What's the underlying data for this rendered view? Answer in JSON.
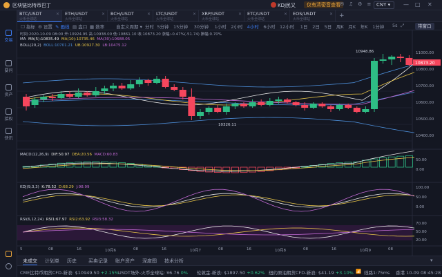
{
  "titlebar": {
    "app_title": "区块链比特币巴丁",
    "user_name": "KDJ民又",
    "badge": "仅有清密音查看",
    "currency": "CNY"
  },
  "sidebar": {
    "items": [
      {
        "label": "交易",
        "icon": "exchange-icon"
      },
      {
        "label": "要问",
        "icon": "news-icon"
      },
      {
        "label": "资产",
        "icon": "wallet-icon"
      },
      {
        "label": "接权",
        "icon": "key-icon"
      },
      {
        "label": "快讯",
        "icon": "flash-icon"
      }
    ]
  },
  "tabs": [
    {
      "name": "BTC/USDT",
      "sub": "火币全球站"
    },
    {
      "name": "ETH/USDT",
      "sub": "火币全球站"
    },
    {
      "name": "BCH/USDT",
      "sub": "火币全球站"
    },
    {
      "name": "LTC/USDT",
      "sub": "火币全球站"
    },
    {
      "name": "XRP/USDT",
      "sub": "火币全球站"
    },
    {
      "name": "ETC/USDT",
      "sub": "火币全球站"
    },
    {
      "name": "EOS/USDT",
      "sub": "火币全球站"
    }
  ],
  "toolbar": {
    "items": [
      "指标",
      "设置",
      "画线",
      "盘口",
      "数率"
    ],
    "custom_period": "自定义周期",
    "periods": [
      "分时",
      "5分钟",
      "15分钟",
      "30分钟",
      "1小时",
      "2小时",
      "4小时",
      "6小时",
      "12小时",
      "1日",
      "2日",
      "5日",
      "周K",
      "月K",
      "年K",
      "1分钟"
    ],
    "active_period": "4小时",
    "right_label": "5s",
    "right_button": "带窗口"
  },
  "chart": {
    "info_line": "时间:2020-10-09 08:00  开:10924.95  高:10938.00  低:10861.10  收:10873.20  涨幅:-0.47%(-51.74)  振幅:0.70%",
    "ma_line": {
      "name": "MA",
      "ma5": "MA(5):10835.49",
      "ma10": "MA(10):10735.46",
      "ma30": "MA(30):10688.05"
    },
    "boll_line": {
      "name": "BOLL(20,2)",
      "boll": "BOLL:10701.21",
      "ub": "UB:10927.30",
      "lb": "LB:10475.12"
    },
    "price_axis": [
      "11000.00",
      "10800.00",
      "10700.00",
      "10600.00",
      "10500.00",
      "10400.00"
    ],
    "current_price": "10873.20",
    "high_label": "10948.86",
    "low_label": "10326.11",
    "macd": {
      "name": "MACD(12,26,9)",
      "dif": "DIF:50.97",
      "dea": "DEA:20.56",
      "macd": "MACD:60.83",
      "axis": [
        "50.00",
        "0.00"
      ]
    },
    "kdj": {
      "name": "KDJ(9,3,3)",
      "k": "K:78.52",
      "d": "D:68.29",
      "j": "J:98.99",
      "axis": [
        "100.00",
        "50.00",
        "0.00"
      ]
    },
    "rsi": {
      "name": "RSI(6,12,24)",
      "rsi1": "RSI1:67.97",
      "rsi2": "RSI2:63.92",
      "rsi3": "RSI3:58.32",
      "axis": [
        "70.00",
        "50.00",
        "20.00"
      ]
    },
    "time_axis": [
      "5",
      "08",
      "16",
      "10月6",
      "08",
      "16",
      "10月7",
      "08",
      "16",
      "10月8",
      "08",
      "16",
      "10月9",
      "08"
    ]
  },
  "colors": {
    "up": "#2ebd85",
    "down": "#f6465d",
    "accent": "#3d7df5",
    "ma5": "#e8e8e8",
    "ma10": "#e8c547",
    "ma30": "#c36bd6",
    "boll": "#4c8ed9"
  },
  "bottom_tabs": [
    "未成交",
    "计划单",
    "历史",
    "买卖记录",
    "账户资产",
    "深度图",
    "技术分析"
  ],
  "status_bar": {
    "item1_name": "CME比特币期货CFD-新浪:",
    "item1_value": "$10949.50",
    "item1_change": "+2.15%",
    "item2_name": "USDT场外-火币全球站:",
    "item2_value": "¥6.76",
    "item2_change": "0%",
    "item3_name": "伦敦金-新浪:",
    "item3_value": "$1897.50",
    "item3_change": "+0.62%",
    "item4_name": "纽约原油期货CFD-新浪:",
    "item4_value": "$41.19",
    "item4_change": "+3.10%",
    "latency": "线路1:75ms",
    "clock": "香港 10-09 08:45:28"
  }
}
